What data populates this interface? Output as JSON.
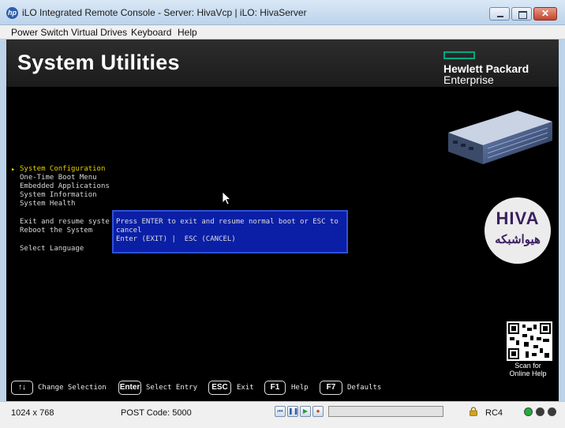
{
  "window": {
    "app_icon": "hp-logo-icon",
    "title": "iLO Integrated Remote Console - Server: HivaVcp | iLO: HivaServer",
    "controls": [
      "minimize-icon",
      "maximize-icon",
      "close-icon"
    ]
  },
  "menubar": {
    "items": [
      "Power Switch",
      "Virtual Drives",
      "Keyboard",
      "Help"
    ]
  },
  "console": {
    "banner_title": "System Utilities",
    "brand": {
      "line1": "Hewlett Packard",
      "line2": "Enterprise",
      "color": "#01a982"
    },
    "menu": {
      "selected_marker": "▸",
      "items": [
        "System Configuration",
        "One-Time Boot Menu",
        "Embedded Applications",
        "System Information",
        "System Health",
        "Exit and resume syste",
        "Reboot the System",
        "Select Language"
      ],
      "selected_color": "#e6d200"
    },
    "dialog": {
      "line1": "Press ENTER to exit and resume normal boot or ESC to",
      "line2": "cancel",
      "line3": "Enter (EXIT) |  ESC (CANCEL)",
      "background": "#0a1fa5"
    },
    "watermark": {
      "latin": "HIVA",
      "persian": "هیواشبکه"
    },
    "qr": {
      "caption_line1": "Scan for",
      "caption_line2": "Online Help"
    },
    "keys": [
      {
        "key": "↑↓",
        "label": "Change Selection"
      },
      {
        "key": "Enter",
        "label": "Select Entry"
      },
      {
        "key": "ESC",
        "label": "Exit"
      },
      {
        "key": "F1",
        "label": "Help"
      },
      {
        "key": "F7",
        "label": "Defaults"
      }
    ]
  },
  "statusbar": {
    "resolution": "1024 x 768",
    "post_code": "POST Code: 5000",
    "playback_buttons": [
      "skip-back-icon",
      "pause-icon",
      "play-icon",
      "record-icon"
    ],
    "progress": 0,
    "encryption": "RC4",
    "leds": [
      "#1fae3c",
      "#3a3a3a",
      "#3a3a3a"
    ]
  }
}
